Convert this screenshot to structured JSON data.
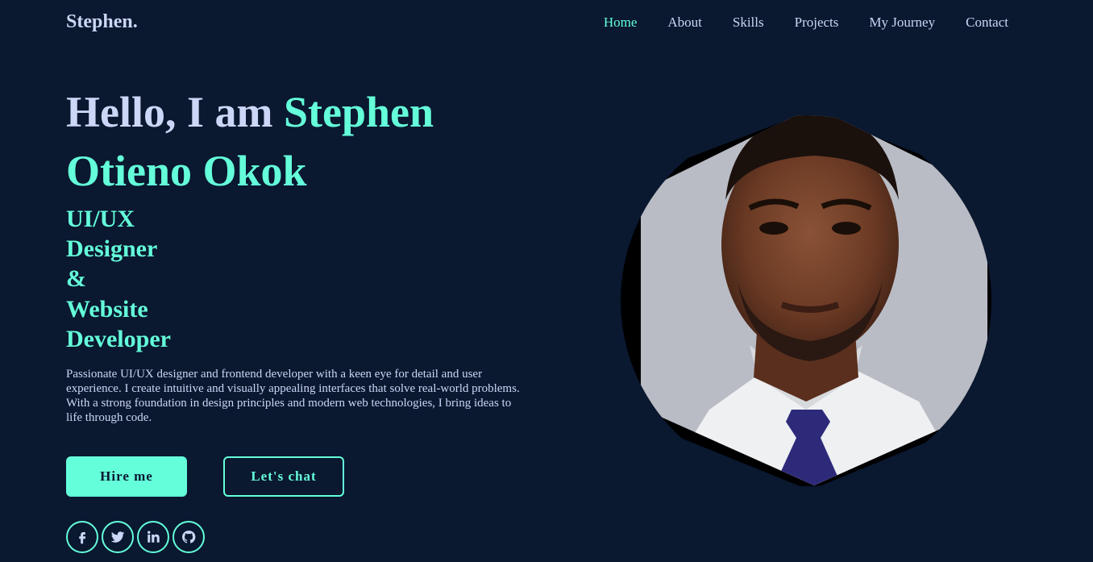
{
  "nav": {
    "logo": "Stephen.",
    "links": [
      {
        "label": "Home",
        "active": true
      },
      {
        "label": "About"
      },
      {
        "label": "Skills"
      },
      {
        "label": "Projects"
      },
      {
        "label": "My Journey"
      },
      {
        "label": "Contact"
      }
    ]
  },
  "hero": {
    "greeting": "Hello, I am ",
    "name_line1": "Stephen",
    "name_line2": "Otieno Okok",
    "role_lines": [
      "UI/UX",
      "Designer",
      "&",
      "Website",
      "Developer"
    ],
    "description": "Passionate UI/UX designer and frontend developer with a keen eye for detail and user experience. I create intuitive and visually appealing interfaces that solve real-world problems. With a strong foundation in design principles and modern web technologies, I bring ideas to life through code.",
    "hire_label": "Hire me",
    "chat_label": "Let's chat"
  },
  "socials": [
    {
      "icon": "facebook-icon"
    },
    {
      "icon": "twitter-icon"
    },
    {
      "icon": "linkedin-icon"
    },
    {
      "icon": "github-icon"
    }
  ],
  "colors": {
    "background": "#0a1830",
    "accent": "#64ffda",
    "text": "#ccd6f6"
  }
}
